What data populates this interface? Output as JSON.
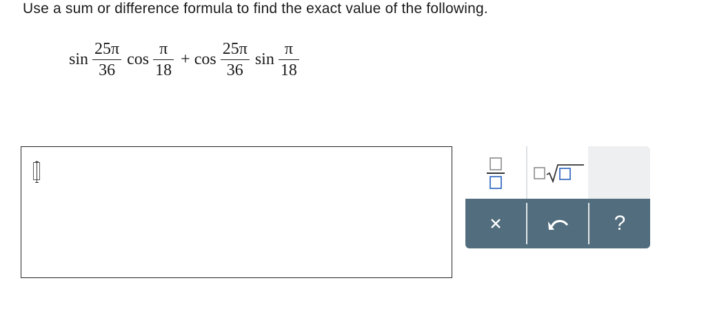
{
  "question": {
    "text": "Use a sum or difference formula to find the exact value of the following."
  },
  "expression": {
    "fn1": "sin",
    "frac1": {
      "num": "25π",
      "den": "36"
    },
    "fn2": "cos",
    "frac2": {
      "num": "π",
      "den": "18"
    },
    "plus": "+",
    "fn3": "cos",
    "frac3": {
      "num": "25π",
      "den": "36"
    },
    "fn4": "sin",
    "frac4": {
      "num": "π",
      "den": "18"
    }
  },
  "answer": {
    "value": ""
  },
  "palette": {
    "buttons": [
      {
        "name": "fraction-button",
        "icon": "fraction-icon"
      },
      {
        "name": "sqrt-button",
        "icon": "square-root-icon"
      }
    ],
    "actions": [
      {
        "name": "clear-button",
        "icon": "close-icon",
        "label": "×"
      },
      {
        "name": "undo-button",
        "icon": "undo-icon"
      },
      {
        "name": "help-button",
        "icon": "help-icon",
        "label": "?"
      }
    ],
    "colors": {
      "action_bar": "#526d7d",
      "palette_bg": "#eeeff1"
    }
  }
}
